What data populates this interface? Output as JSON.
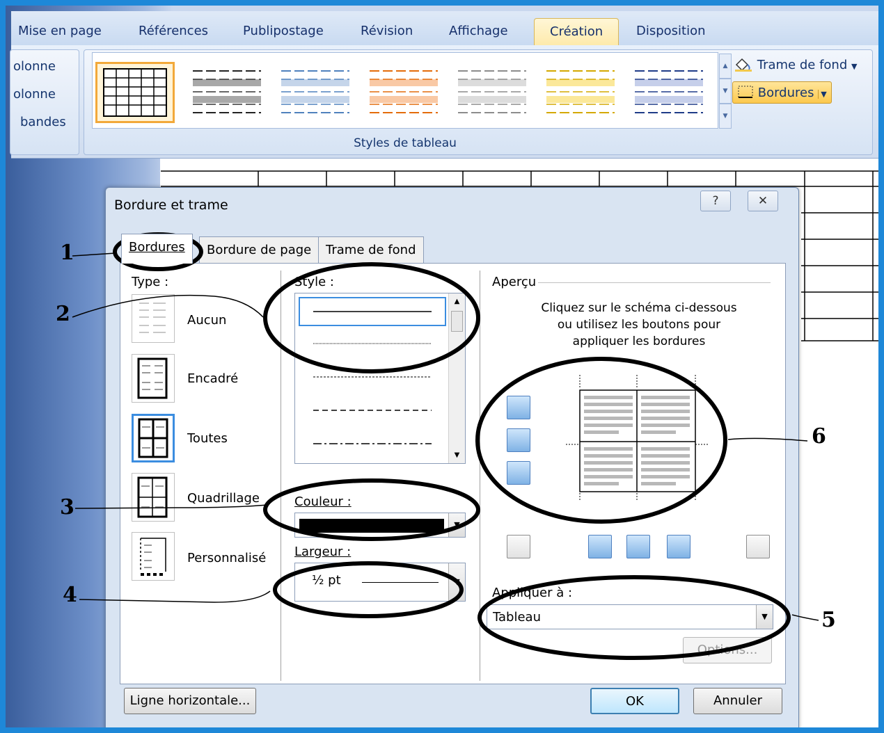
{
  "ribbon": {
    "tabs": [
      "Mise en page",
      "Références",
      "Publipostage",
      "Révision",
      "Affichage",
      "Création",
      "Disposition"
    ],
    "active_tab": "Création",
    "table_style_options": [
      "olonne",
      "olonne",
      "bandes"
    ],
    "styles_group_caption": "Styles de tableau",
    "shading_label": "Trame de fond",
    "borders_label": "Bordures"
  },
  "dialog": {
    "title": "Bordure et trame",
    "help_label": "?",
    "close_label": "✕",
    "tabs": [
      "Bordures",
      "Bordure de page",
      "Trame de fond"
    ],
    "type": {
      "label": "Type :",
      "options": [
        "Aucun",
        "Encadré",
        "Toutes",
        "Quadrillage",
        "Personnalisé"
      ],
      "selected": "Toutes"
    },
    "style_label": "Style :",
    "color_label": "Couleur :",
    "color_value": "#000000",
    "width_label": "Largeur :",
    "width_value": "½ pt",
    "preview": {
      "label": "Aperçu",
      "instructions": [
        "Cliquez sur le schéma ci-dessous",
        "ou utilisez les boutons pour",
        "appliquer les bordures"
      ]
    },
    "apply_to_label": "Appliquer à :",
    "apply_to_value": "Tableau",
    "options_button": "Options...",
    "horizontal_line_button": "Ligne horizontale...",
    "ok_button": "OK",
    "cancel_button": "Annuler"
  },
  "callouts": [
    "1",
    "2",
    "3",
    "4",
    "5",
    "6"
  ],
  "colors": {
    "frame_border": "#1E88D8",
    "ribbon_active_tab": "#FDE9A8",
    "selection_blue": "#3B8DE0",
    "style_selected": "#F2A93A"
  }
}
